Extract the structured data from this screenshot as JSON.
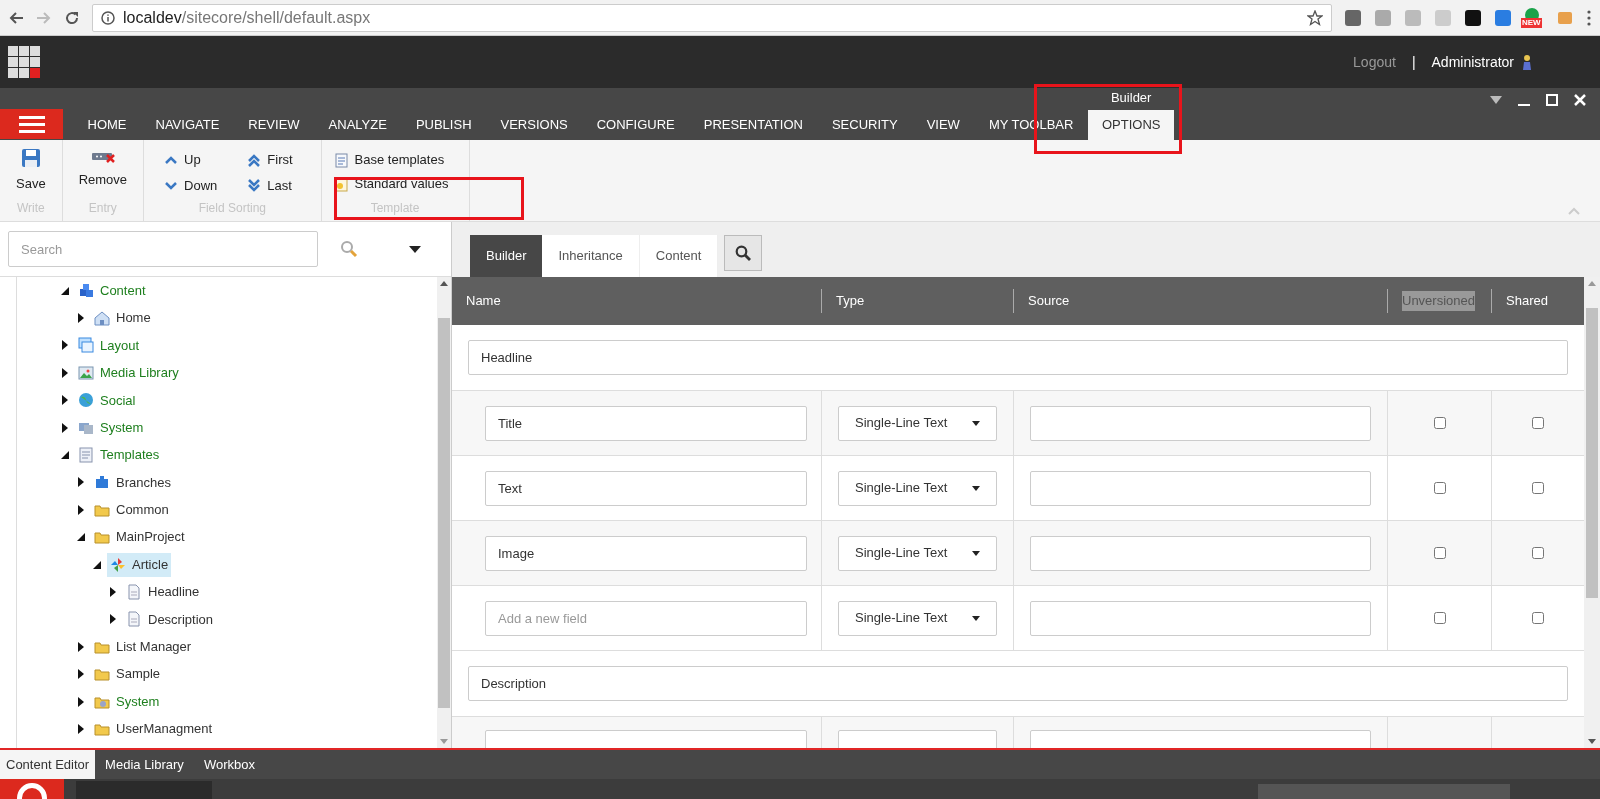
{
  "browser": {
    "url_host": "localdev",
    "url_path": "/sitecore/shell/default.aspx",
    "extension_badge": "NEW"
  },
  "header": {
    "logout": "Logout",
    "separator": "|",
    "user": "Administrator"
  },
  "ribbon_tabs": [
    {
      "label": "HOME",
      "selected": false
    },
    {
      "label": "NAVIGATE",
      "selected": false
    },
    {
      "label": "REVIEW",
      "selected": false
    },
    {
      "label": "ANALYZE",
      "selected": false
    },
    {
      "label": "PUBLISH",
      "selected": false
    },
    {
      "label": "VERSIONS",
      "selected": false
    },
    {
      "label": "CONFIGURE",
      "selected": false
    },
    {
      "label": "PRESENTATION",
      "selected": false
    },
    {
      "label": "SECURITY",
      "selected": false
    },
    {
      "label": "VIEW",
      "selected": false
    },
    {
      "label": "MY TOOLBAR",
      "selected": false
    },
    {
      "label": "OPTIONS",
      "selected": true,
      "context": "Builder"
    }
  ],
  "ribbon_groups": [
    {
      "label": "Write",
      "kind": "large",
      "buttons": [
        {
          "label": "Save",
          "kind": "save"
        }
      ]
    },
    {
      "label": "Entry",
      "kind": "large",
      "buttons": [
        {
          "label": "Remove",
          "kind": "remove"
        }
      ]
    },
    {
      "label": "Field Sorting",
      "kind": "grid",
      "buttons": [
        {
          "label": "Up",
          "kind": "up"
        },
        {
          "label": "First",
          "kind": "first"
        },
        {
          "label": "Down",
          "kind": "down"
        },
        {
          "label": "Last",
          "kind": "last"
        }
      ]
    },
    {
      "label": "Template",
      "kind": "list",
      "buttons": [
        {
          "label": "Base templates",
          "kind": "doc"
        },
        {
          "label": "Standard values",
          "kind": "docstar"
        }
      ]
    }
  ],
  "search": {
    "placeholder": "Search"
  },
  "tree": [
    {
      "label": "Content",
      "kind": "cubes",
      "color": "#1e7f1e",
      "expanded": true,
      "selected": false,
      "children": [
        {
          "label": "Home",
          "kind": "home",
          "color": "#333333",
          "expanded": false,
          "selected": false
        }
      ]
    },
    {
      "label": "Layout",
      "kind": "window",
      "color": "#1e7f1e",
      "expanded": false,
      "selected": false
    },
    {
      "label": "Media Library",
      "kind": "image",
      "color": "#1e7f1e",
      "expanded": false,
      "selected": false
    },
    {
      "label": "Social",
      "kind": "globe",
      "color": "#1e7f1e",
      "expanded": false,
      "selected": false
    },
    {
      "label": "System",
      "kind": "computer",
      "color": "#1e7f1e",
      "expanded": false,
      "selected": false
    },
    {
      "label": "Templates",
      "kind": "doc",
      "color": "#1e7f1e",
      "expanded": true,
      "selected": false,
      "children": [
        {
          "label": "Branches",
          "kind": "puzzle",
          "color": "#333333",
          "expanded": false,
          "selected": false
        },
        {
          "label": "Common",
          "kind": "folder",
          "color": "#333333",
          "expanded": false,
          "selected": false
        },
        {
          "label": "MainProject",
          "kind": "folder",
          "color": "#333333",
          "expanded": true,
          "selected": false,
          "children": [
            {
              "label": "Article",
              "kind": "pinwheel",
              "color": "#333333",
              "expanded": true,
              "selected": true,
              "children": [
                {
                  "label": "Headline",
                  "kind": "page",
                  "color": "#333333",
                  "expanded": false,
                  "selected": false
                },
                {
                  "label": "Description",
                  "kind": "page",
                  "color": "#333333",
                  "expanded": false,
                  "selected": false
                }
              ]
            }
          ]
        },
        {
          "label": "List Manager",
          "kind": "folder",
          "color": "#333333",
          "expanded": false,
          "selected": false
        },
        {
          "label": "Sample",
          "kind": "folder",
          "color": "#333333",
          "expanded": false,
          "selected": false
        },
        {
          "label": "System",
          "kind": "gearfolder",
          "color": "#1e7f1e",
          "expanded": false,
          "selected": false
        },
        {
          "label": "UserManagment",
          "kind": "folder",
          "color": "#333333",
          "expanded": false,
          "selected": false
        }
      ]
    }
  ],
  "editor_tabs": [
    {
      "label": "Builder",
      "selected": true
    },
    {
      "label": "Inheritance",
      "selected": false
    },
    {
      "label": "Content",
      "selected": false
    }
  ],
  "table": {
    "columns": [
      {
        "label": "Name",
        "highlighted": false
      },
      {
        "label": "Type",
        "highlighted": false
      },
      {
        "label": "Source",
        "highlighted": false
      },
      {
        "label": "Unversioned",
        "highlighted": true
      },
      {
        "label": "Shared",
        "highlighted": false
      }
    ],
    "sections": [
      {
        "name": "Headline",
        "rows": [
          {
            "kind": "field",
            "name": "Title",
            "type": "Single-Line Text",
            "unversioned": false,
            "shared": false
          },
          {
            "kind": "field",
            "name": "Text",
            "type": "Single-Line Text",
            "unversioned": false,
            "shared": false
          },
          {
            "kind": "field",
            "name": "Image",
            "type": "Single-Line Text",
            "unversioned": false,
            "shared": false
          },
          {
            "kind": "field",
            "placeholder": "Add a new field",
            "type": "Single-Line Text",
            "unversioned": false,
            "shared": false
          }
        ]
      },
      {
        "name": "Description",
        "rows": [
          {
            "kind": "cut"
          }
        ]
      }
    ]
  },
  "bottom_tabs": [
    {
      "label": "Content Editor",
      "selected": true
    },
    {
      "label": "Media Library",
      "selected": false
    },
    {
      "label": "Workbox",
      "selected": false
    }
  ]
}
